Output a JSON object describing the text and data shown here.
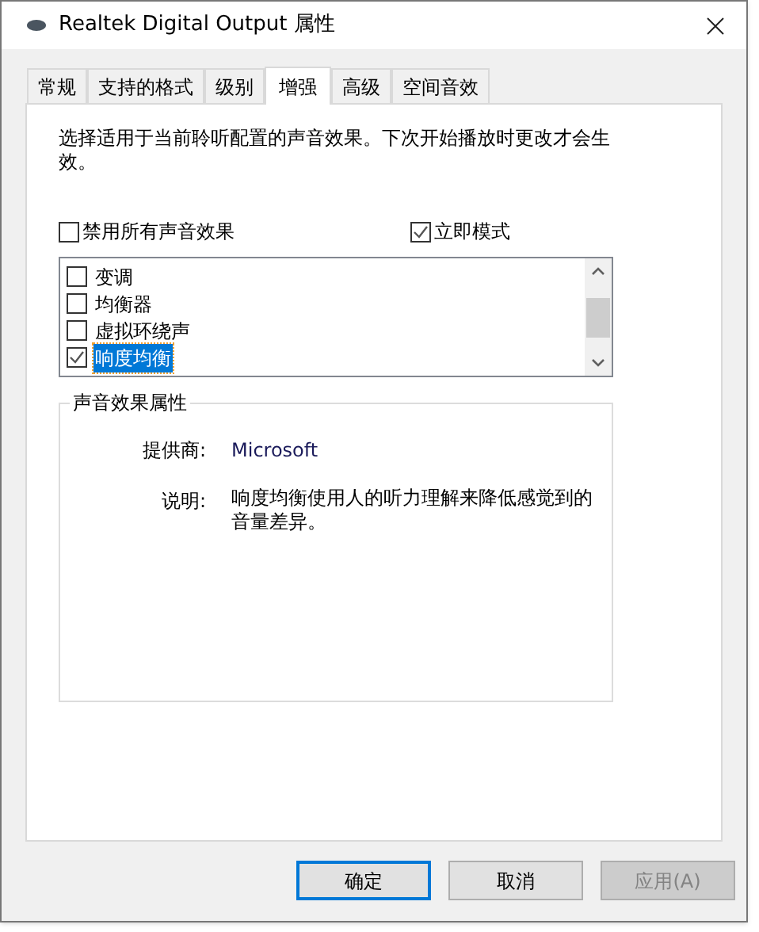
{
  "window": {
    "title": "Realtek Digital Output 属性"
  },
  "tabs": [
    {
      "label": "常规",
      "selected": false
    },
    {
      "label": "支持的格式",
      "selected": false
    },
    {
      "label": "级别",
      "selected": false
    },
    {
      "label": "增强",
      "selected": true
    },
    {
      "label": "高级",
      "selected": false
    },
    {
      "label": "空间音效",
      "selected": false
    }
  ],
  "intro": "选择适用于当前聆听配置的声音效果。下次开始播放时更改才会生效。",
  "disable_all": {
    "label": "禁用所有声音效果",
    "checked": false
  },
  "immediate_mode": {
    "label": "立即模式",
    "checked": true
  },
  "effects": [
    {
      "label": "变调",
      "checked": false,
      "selected": false
    },
    {
      "label": "均衡器",
      "checked": false,
      "selected": false
    },
    {
      "label": "虚拟环绕声",
      "checked": false,
      "selected": false
    },
    {
      "label": "响度均衡",
      "checked": true,
      "selected": true
    }
  ],
  "properties": {
    "title": "声音效果属性",
    "provider_label": "提供商:",
    "provider": "Microsoft",
    "description_label": "说明:",
    "description": "响度均衡使用人的听力理解来降低感觉到的音量差异。"
  },
  "buttons": [
    {
      "label": "确定",
      "kind": "default",
      "disabled": false
    },
    {
      "label": "取消",
      "kind": "normal",
      "disabled": false
    },
    {
      "label": "应用(A)",
      "kind": "normal",
      "disabled": true
    }
  ]
}
